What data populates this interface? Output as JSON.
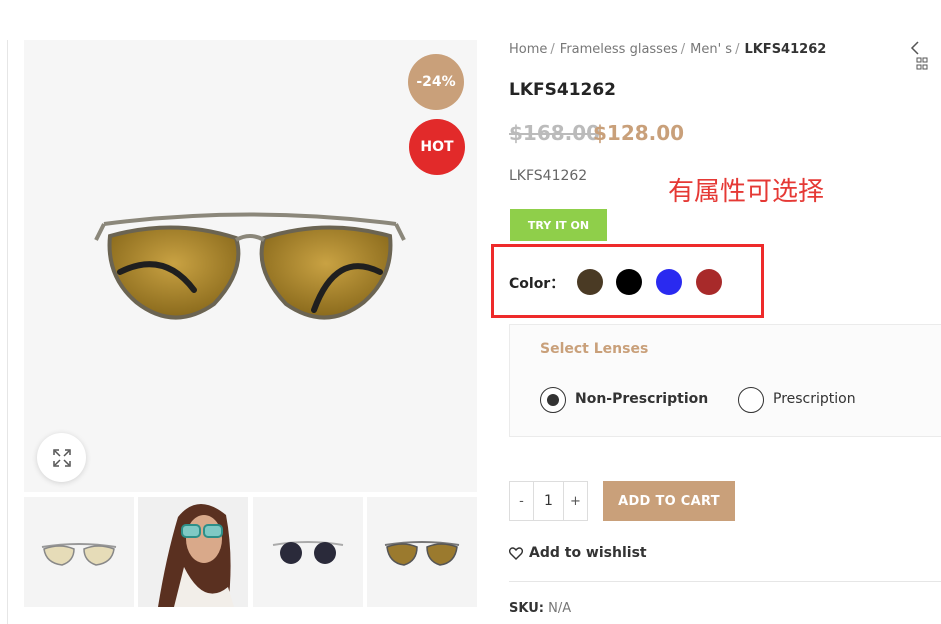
{
  "badges": {
    "sale": "-24%",
    "hot": "HOT"
  },
  "breadcrumb": {
    "items": [
      "Home",
      "Frameless glasses",
      "Men' s"
    ],
    "current": "LKFS41262",
    "separator": "/"
  },
  "product": {
    "title": "LKFS41262",
    "price_old": "$168.00",
    "price_new": "$128.00",
    "short_desc": "LKFS41262"
  },
  "annotation": "有属性可选择",
  "try_button": "TRY IT ON",
  "color": {
    "label": "Color：",
    "swatches": [
      "#4a3a24",
      "#000000",
      "#2a2af0",
      "#a82a2a"
    ]
  },
  "lenses": {
    "title": "Select Lenses",
    "options": [
      {
        "label": "Non-Prescription",
        "selected": true
      },
      {
        "label": "Prescription",
        "selected": false
      }
    ]
  },
  "quantity": {
    "minus": "-",
    "value": "1",
    "plus": "+"
  },
  "cart_button": "ADD TO CART",
  "wishlist": "Add to wishlist",
  "meta": {
    "sku_label": "SKU:",
    "sku_value": "N/A"
  },
  "colors": {
    "accent": "#c9a07a",
    "hot": "#e22a2a",
    "try": "#8fcf4a",
    "annotation": "#e53935"
  }
}
